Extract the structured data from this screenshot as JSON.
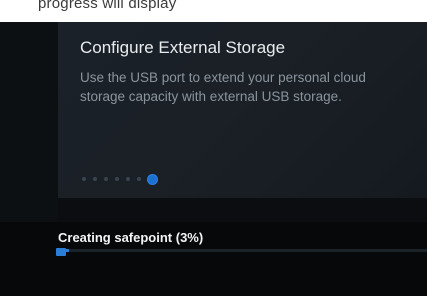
{
  "caption": {
    "text": "progress will display"
  },
  "card": {
    "title": "Configure External Storage",
    "body": "Use the USB port to extend your personal cloud storage capacity with external USB storage.",
    "pager": {
      "total": 7,
      "active_index": 6
    }
  },
  "progress": {
    "label": "Creating safepoint (3%)",
    "percent": 3,
    "accent": "#2a7ed8"
  }
}
